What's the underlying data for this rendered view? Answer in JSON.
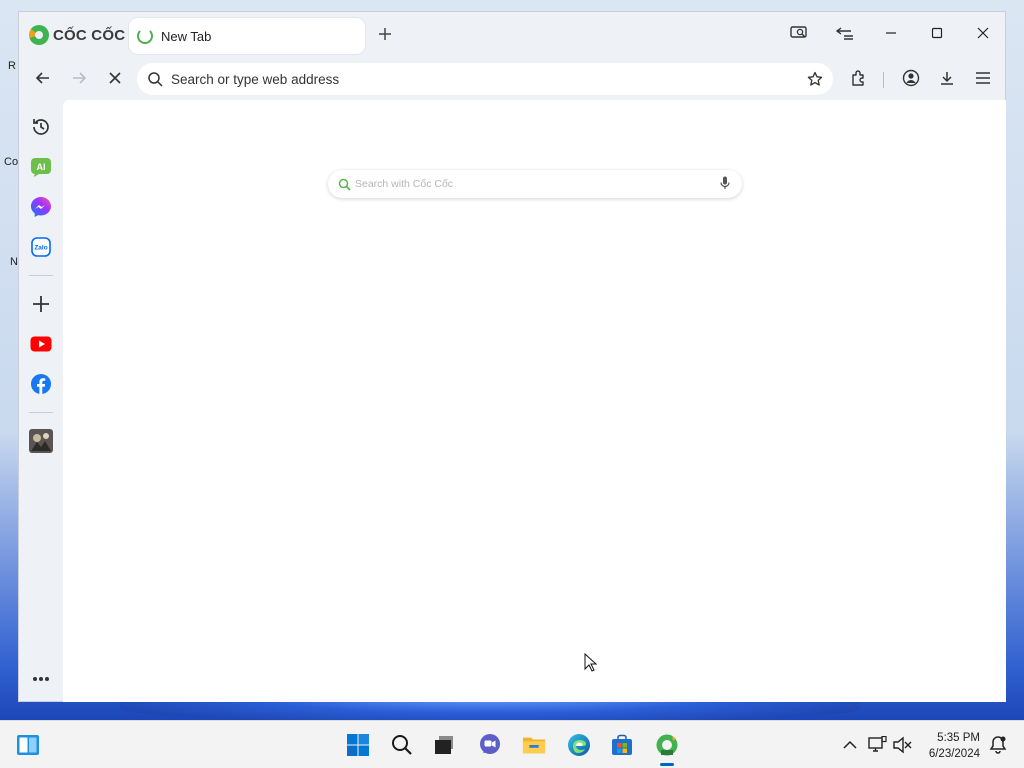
{
  "browser": {
    "brand": "CỐC CỐC",
    "tab": {
      "title": "New Tab"
    },
    "address_bar": {
      "placeholder": "Search or type web address"
    }
  },
  "page": {
    "search": {
      "placeholder": "Search with Cốc Cốc"
    }
  },
  "desktop_fragments": [
    "R",
    "Co",
    "N"
  ],
  "taskbar": {
    "time": "5:35 PM",
    "date": "6/23/2024"
  },
  "colors": {
    "accent": "#0067c0",
    "brand_green": "#3fb34f",
    "window_bg": "#eef1f6"
  }
}
